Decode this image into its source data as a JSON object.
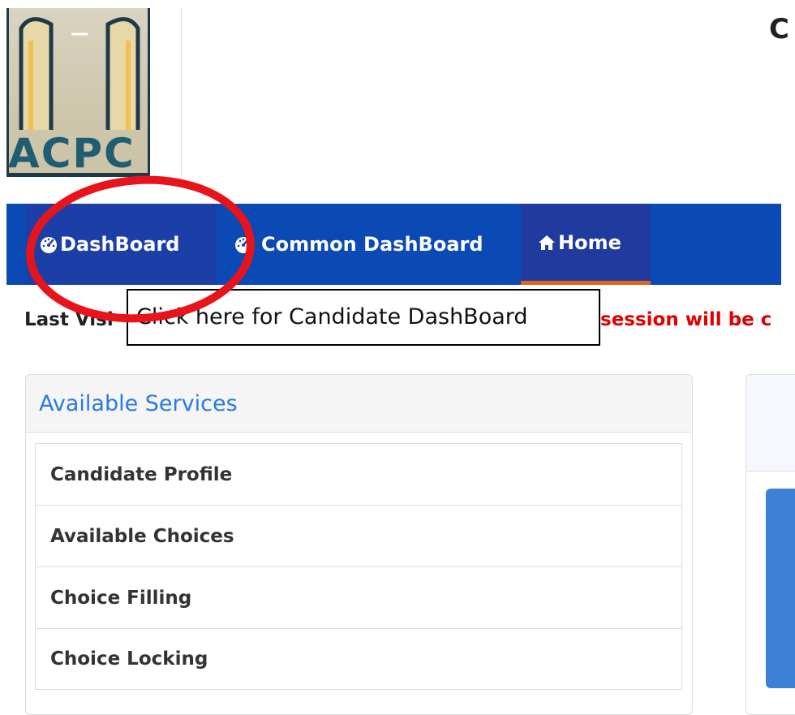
{
  "header": {
    "logo_text": "ACPC",
    "title_partial": "C"
  },
  "navbar": {
    "items": [
      {
        "label": "DashBoard",
        "icon": "dashboard-icon"
      },
      {
        "label": "Common DashBoard",
        "icon": "dashboard-icon"
      },
      {
        "label": "Home",
        "icon": "home-icon"
      }
    ],
    "colors": {
      "background": "#0b49b4",
      "active_item": "#1b3fa6",
      "home_underline": "#e4621b"
    }
  },
  "info_bar": {
    "last_visited_partial": "Last Visi",
    "session_partial": "session will be c"
  },
  "tooltip": {
    "text": "Click here for Candidate DashBoard"
  },
  "services": {
    "heading": "Available Services",
    "items": [
      "Candidate Profile",
      "Available Choices",
      "Choice Filling",
      "Choice Locking"
    ]
  }
}
